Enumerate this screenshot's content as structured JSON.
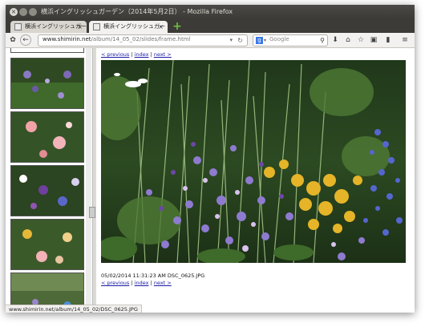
{
  "window": {
    "title": "横浜イングリッシュガーデン（2014年5月2日） - Mozilla Firefox"
  },
  "tabs": [
    {
      "label": "横浜イングリッシュガー"
    },
    {
      "label": "横浜イングリッシュガー"
    }
  ],
  "toolbar": {
    "url_host": "www.shimirin.net",
    "url_path": "/album/14_05_02/slides/frame.html",
    "search_placeholder": "Google",
    "search_engine_letter": "g"
  },
  "slide": {
    "nav_prev": "< previous",
    "nav_index": "index",
    "nav_next": "next >",
    "sep": "|",
    "caption": "05/02/2014 11:31:23 AM DSC_0625.JPG"
  },
  "status_bar": {
    "text": "www.shimirin.net/album/14_05_02/DSC_0625.JPG"
  },
  "colors": {
    "link": "#1a1aa6",
    "titlebar": "#3c3b37",
    "window_bg": "#f2f1ef"
  }
}
